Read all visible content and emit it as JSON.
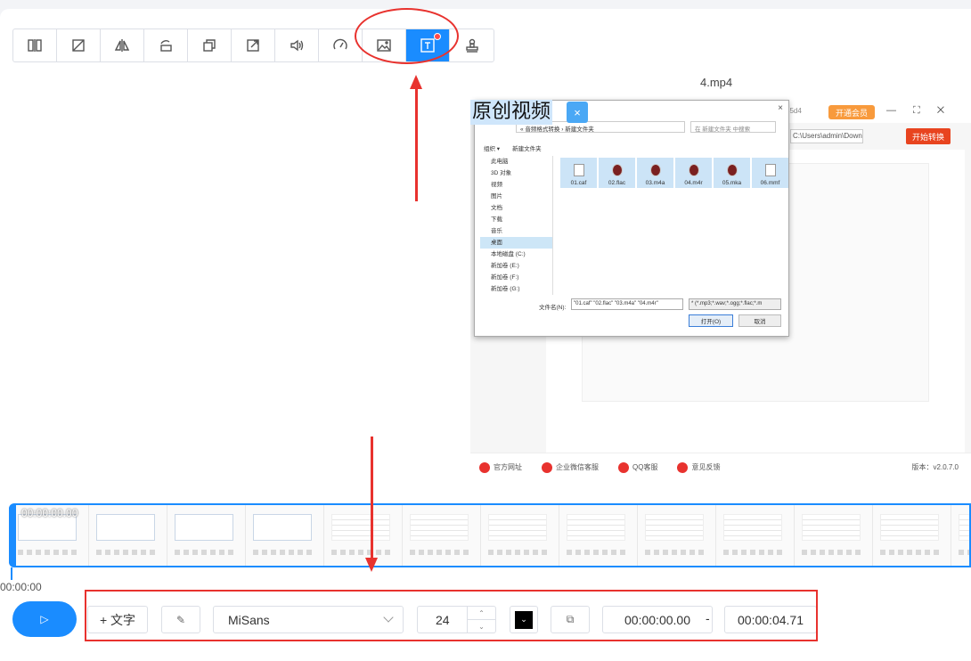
{
  "toolbar": {
    "tools": [
      {
        "name": "split-icon"
      },
      {
        "name": "crop-icon"
      },
      {
        "name": "mirror-icon"
      },
      {
        "name": "rotate-icon"
      },
      {
        "name": "resize-icon"
      },
      {
        "name": "export-icon"
      },
      {
        "name": "volume-icon"
      },
      {
        "name": "speed-icon"
      },
      {
        "name": "image-icon"
      },
      {
        "name": "text-icon"
      },
      {
        "name": "stamp-icon"
      }
    ]
  },
  "preview": {
    "filename": "4.mp4",
    "overlay_text": "原创视频",
    "overlay_close": "×"
  },
  "app_shot": {
    "tag": "85d4",
    "vip": "开通会员",
    "win_ctrls": "— ⛶ ✕",
    "path": "C:\\Users\\admin\\Downlo",
    "convert": "开始转换",
    "footer": {
      "site": "官方网址",
      "wechat": "企业微信客服",
      "qq": "QQ客服",
      "feedback": "意见反馈",
      "version": "版本：v2.0.7.0"
    }
  },
  "dialog": {
    "close": "×",
    "breadcrumb": "« 音频格式转换 › 新建文件夹",
    "search": "在 新建文件夹 中搜索",
    "organize": "组织 ▾",
    "new_folder": "新建文件夹",
    "sidebar": [
      "此电脑",
      "3D 对象",
      "视频",
      "图片",
      "文档",
      "下载",
      "音乐",
      "桌面",
      "本地磁盘 (C:)",
      "新加卷 (E:)",
      "新加卷 (F:)",
      "新加卷 (G:)"
    ],
    "selected_side": 7,
    "files": [
      "01.caf",
      "02.flac",
      "03.m4a",
      "04.m4r",
      "05.mka",
      "06.mmf"
    ],
    "filename_label": "文件名(N):",
    "filename_value": "\"01.caf\" \"02.flac\" \"03.m4a\" \"04.m4r\"",
    "filter": "* (*.mp3;*.wav;*.ogg;*.flac;*.m",
    "open": "打开(O)",
    "cancel": "取消"
  },
  "timeline": {
    "start_time": "00:00:00.00",
    "cursor_time": "00:00:00"
  },
  "controls": {
    "play": "▷",
    "add_text": "+ 文字",
    "edit": "✎",
    "font": "MiSans",
    "size": "24",
    "spin_up": "⌃",
    "spin_down": "⌄",
    "color_glyph": "⌄",
    "style": "⧉",
    "start": "00:00:00.00",
    "dash": "-",
    "end": "00:00:04.71"
  },
  "colors": {
    "accent": "#1a8cff",
    "annotation": "#e8322e"
  }
}
